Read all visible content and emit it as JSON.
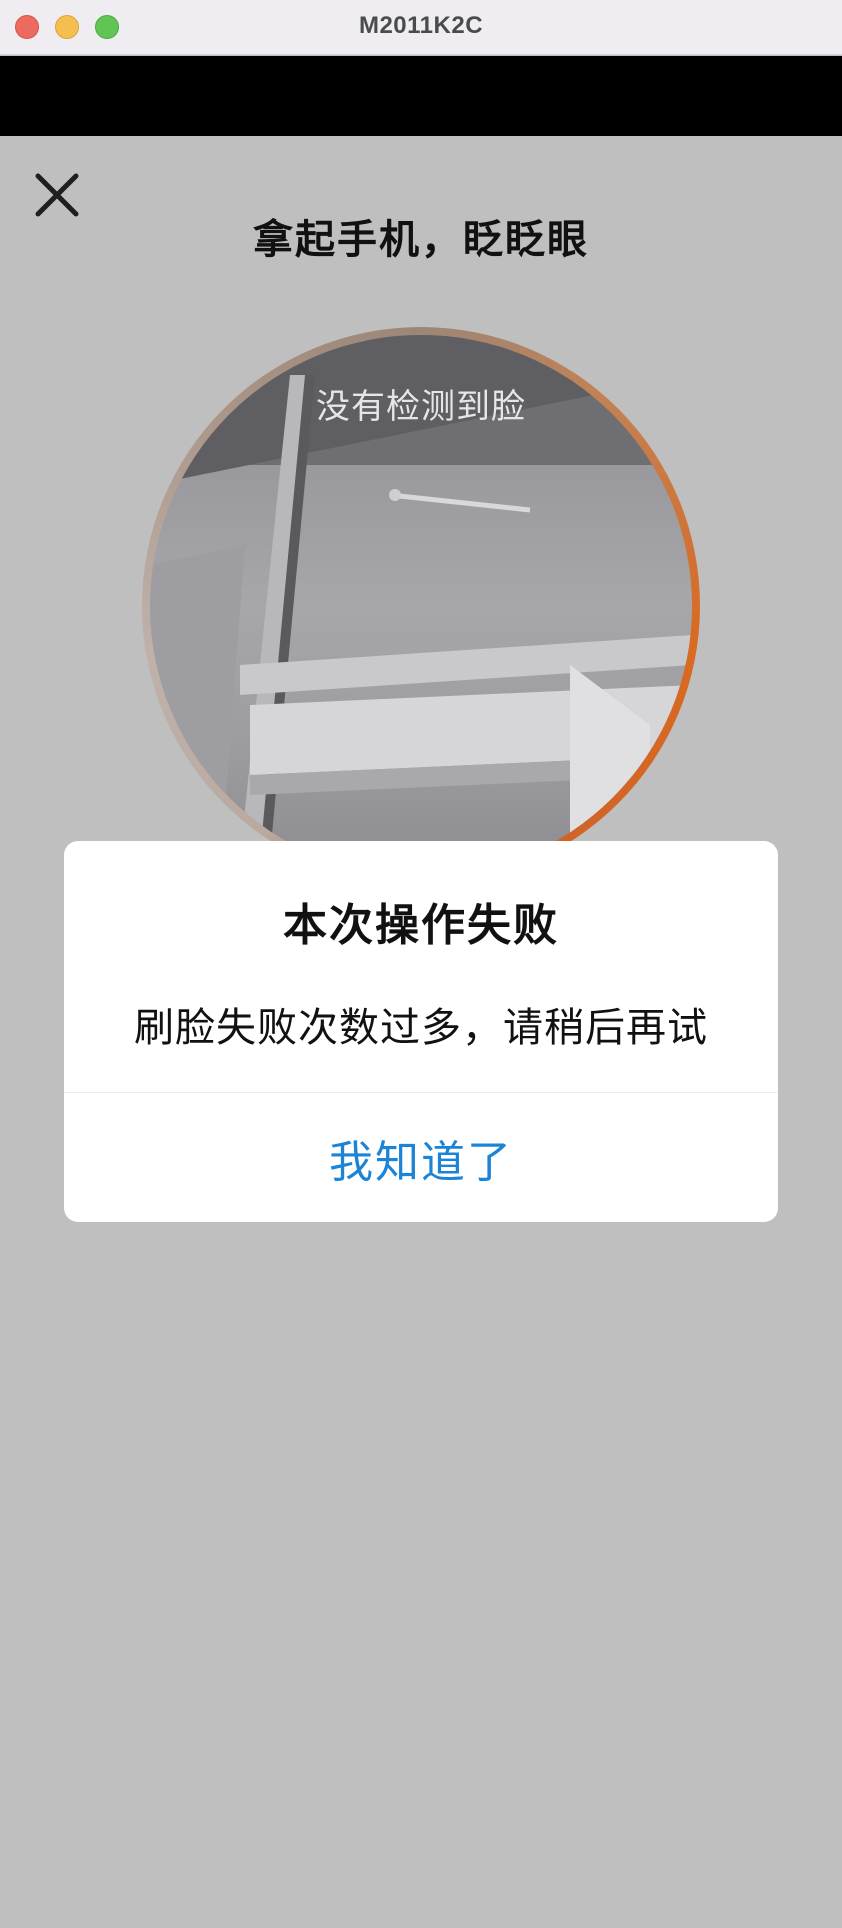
{
  "window": {
    "title": "M2011K2C"
  },
  "screen": {
    "instruction": "拿起手机，眨眨眼",
    "close_icon": "close-icon",
    "camera": {
      "hint": "没有检测到脸",
      "ring_colors": [
        "#9c8677",
        "#d86a21",
        "#bfb2ab"
      ]
    }
  },
  "dialog": {
    "title": "本次操作失败",
    "message": "刷脸失败次数过多，请稍后再试",
    "button_label": "我知道了",
    "button_color": "#1b84d6"
  }
}
